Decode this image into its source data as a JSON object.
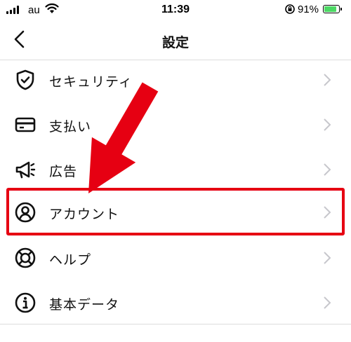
{
  "status_bar": {
    "carrier": "au",
    "time": "11:39",
    "battery_percent": "91%",
    "battery_level": 0.91,
    "battery_color": "#4cd964"
  },
  "nav": {
    "title": "設定",
    "back_icon": "chevron-left-icon"
  },
  "menu": {
    "items": [
      {
        "label": "セキュリティ",
        "icon": "shield-check-icon"
      },
      {
        "label": "支払い",
        "icon": "credit-card-icon"
      },
      {
        "label": "広告",
        "icon": "megaphone-icon"
      },
      {
        "label": "アカウント",
        "icon": "user-circle-icon"
      },
      {
        "label": "ヘルプ",
        "icon": "lifebuoy-icon"
      },
      {
        "label": "基本データ",
        "icon": "info-circle-icon"
      }
    ]
  },
  "annotation": {
    "color": "#e60012",
    "highlighted_item": "アカウント"
  }
}
